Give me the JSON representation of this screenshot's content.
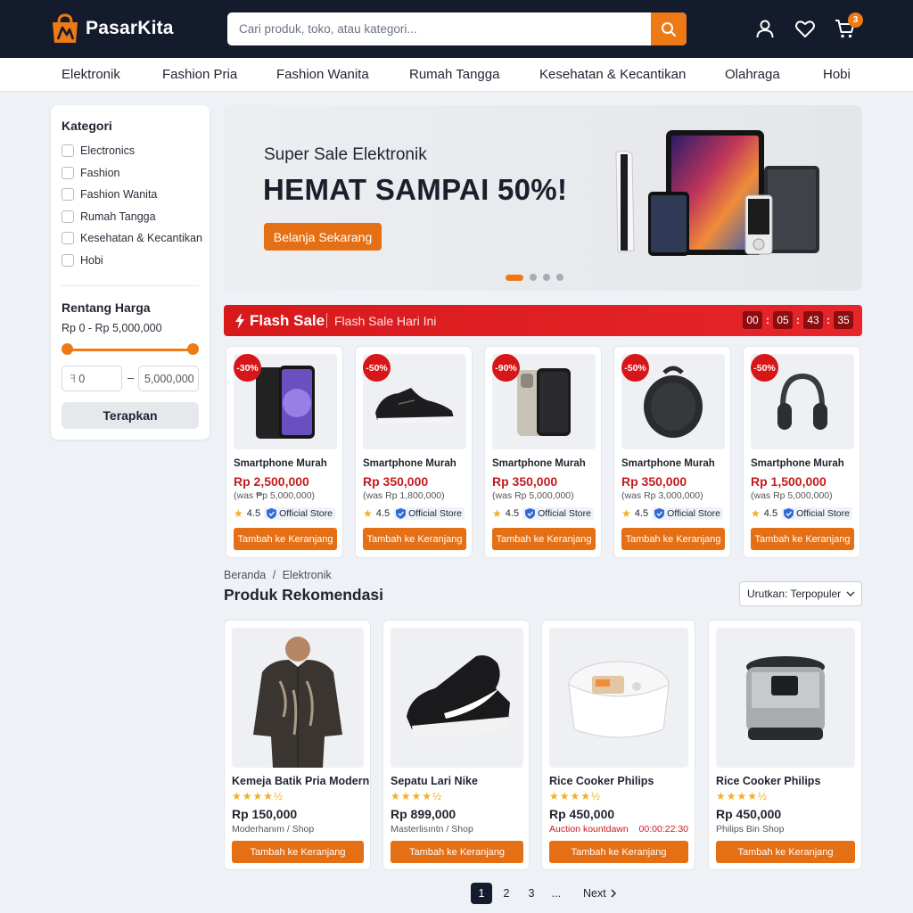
{
  "header": {
    "brand": "PasarKita",
    "search_placeholder": "Cari produk, toko, atau kategori...",
    "cart_count": "3",
    "brand_color": "#ee7a16",
    "icons": [
      "search-icon",
      "user-icon",
      "heart-icon",
      "cart-icon"
    ]
  },
  "categories": [
    "Elektronik",
    "Fashion Pria",
    "Fashion Wanita",
    "Rumah Tangga",
    "Kesehatan & Kecantikan",
    "Olahraga",
    "Hobi"
  ],
  "sidebar": {
    "category_title": "Kategori",
    "filters": [
      "Electronics",
      "Fashion",
      "Fashion Wanita",
      "Rumah Tangga",
      "Kesehatan & Kecantikan",
      "Hobi"
    ],
    "price_title": "Rentang Harga",
    "price_range_text": "Rp 0 - Rp 5,000,000",
    "min_value": "0",
    "min_prefix": "ꟻ",
    "max_value": "5,000,000",
    "range_separator": "–",
    "apply_label": "Terapkan"
  },
  "banner": {
    "subtitle": "Super Sale Elektronik",
    "headline": "HEMAT SAMPAI 50%!",
    "cta": "Belanja Sekarang",
    "slide_count": 4,
    "active_slide": 1
  },
  "flash": {
    "title": "Flash Sale",
    "subtitle": "Flash Sale Hari Ini",
    "timer": [
      "00",
      "05",
      "43",
      "35"
    ],
    "items": [
      {
        "badge": "-30%",
        "name": "Smartphone Murah",
        "price": "Rp 2,500,000",
        "was": "(was ₱p 5,000,000)",
        "rating": "4.5",
        "store": "Official Store",
        "button": "Tambah ke Keranjang",
        "icon": "smartphone-icon"
      },
      {
        "badge": "-50%",
        "name": "Smartphone Murah",
        "price": "Rp 350,000",
        "was": "(was Rp 1,800,000)",
        "rating": "4.5",
        "store": "Official Store",
        "button": "Tambah ke Keranjang",
        "icon": "sneaker-icon"
      },
      {
        "badge": "-90%",
        "name": "Smartphone Murah",
        "price": "Rp 350,000",
        "was": "(was Rp 5,000,000)",
        "rating": "4.5",
        "store": "Official Store",
        "button": "Tambah ke Keranjang",
        "icon": "iphone-icon"
      },
      {
        "badge": "-50%",
        "name": "Smartphone Murah",
        "price": "Rp 350,000",
        "was": "(was Rp 3,000,000)",
        "rating": "4.5",
        "store": "Official Store",
        "button": "Tambah ke Keranjang",
        "icon": "speaker-icon"
      },
      {
        "badge": "-50%",
        "name": "Smartphone Murah",
        "price": "Rp 1,500,000",
        "was": "(was Rp 5,000,000)",
        "rating": "4.5",
        "store": "Official Store",
        "button": "Tambah ke Keranjang",
        "icon": "headphones-icon"
      }
    ]
  },
  "recommend": {
    "breadcrumb": [
      "Beranda",
      "Elektronik"
    ],
    "breadcrumb_sep": "/",
    "title": "Produk Rekomendasi",
    "sort_label": "Urutkan: Terpopuler",
    "items": [
      {
        "name": "Kemeja Batik Pria Modern",
        "stars": "★★★★½",
        "price": "Rp 150,000",
        "shop": "Moderhanım / Shop",
        "button": "Tambah ke Keranjang",
        "icon": "batik-shirt-icon"
      },
      {
        "name": "Sepatu Lari Nike",
        "stars": "★★★★½",
        "price": "Rp 899,000",
        "shop": "Masterlisıntn / Shop",
        "button": "Tambah ke Keranjang",
        "icon": "running-shoe-icon"
      },
      {
        "name": "Rice Cooker Philips",
        "stars": "★★★★½",
        "price": "Rp 450,000",
        "auction_label": "Auction kountdawn",
        "auction_timer": "00:00:22:30",
        "button": "Tambah ke Keranjang",
        "icon": "rice-cooker-icon"
      },
      {
        "name": "Rice Cooker Philips",
        "stars": "★★★★½",
        "price": "Rp 450,000",
        "shop": "Philips Bin Shop",
        "button": "Tambah ke Keranjang",
        "icon": "rice-cooker-icon"
      }
    ]
  },
  "pagination": {
    "pages": [
      "1",
      "2",
      "3",
      "..."
    ],
    "current": "1",
    "next": "Next"
  }
}
